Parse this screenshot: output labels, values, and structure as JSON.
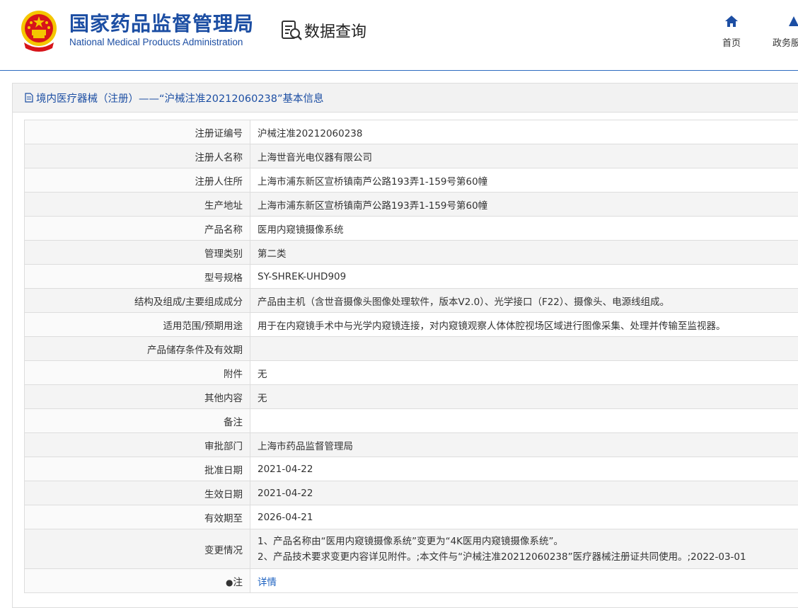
{
  "header": {
    "org_name_cn": "国家药品监督管理局",
    "org_name_en": "National Medical Products Administration",
    "section_title": "数据查询",
    "nav": [
      {
        "label": "首页",
        "icon": "home-icon"
      },
      {
        "label": "政务服",
        "icon": "gov-icon"
      }
    ]
  },
  "panel": {
    "title": "境内医疗器械（注册）——“沪械注准20212060238”基本信息"
  },
  "rows": [
    {
      "label": "注册证编号",
      "value": "沪械注准20212060238"
    },
    {
      "label": "注册人名称",
      "value": "上海世音光电仪器有限公司"
    },
    {
      "label": "注册人住所",
      "value": "上海市浦东新区宣桥镇南芦公路193弄1-159号第60幢"
    },
    {
      "label": "生产地址",
      "value": "上海市浦东新区宣桥镇南芦公路193弄1-159号第60幢"
    },
    {
      "label": "产品名称",
      "value": "医用内窥镜摄像系统"
    },
    {
      "label": "管理类别",
      "value": "第二类"
    },
    {
      "label": "型号规格",
      "value": "SY-SHREK-UHD909"
    },
    {
      "label": "结构及组成/主要组成成分",
      "value": "产品由主机（含世音摄像头图像处理软件，版本V2.0）、光学接口（F22）、摄像头、电源线组成。"
    },
    {
      "label": "适用范围/预期用途",
      "value": "用于在内窥镜手术中与光学内窥镜连接，对内窥镜观察人体体腔视场区域进行图像采集、处理并传输至监视器。"
    },
    {
      "label": "产品储存条件及有效期",
      "value": ""
    },
    {
      "label": "附件",
      "value": "无"
    },
    {
      "label": "其他内容",
      "value": "无"
    },
    {
      "label": "备注",
      "value": ""
    },
    {
      "label": "审批部门",
      "value": "上海市药品监督管理局"
    },
    {
      "label": "批准日期",
      "value": "2021-04-22"
    },
    {
      "label": "生效日期",
      "value": "2021-04-22"
    },
    {
      "label": "有效期至",
      "value": "2026-04-21"
    }
  ],
  "change_row": {
    "label": "变更情况",
    "lines": [
      "1、产品名称由“医用内窥镜摄像系统”变更为“4K医用内窥镜摄像系统”。",
      "2、产品技术要求变更内容详见附件。;本文件与“沪械注准20212060238”医疗器械注册证共同使用。;2022-03-01"
    ]
  },
  "note_row": {
    "label": "注",
    "link": "详情"
  },
  "colors": {
    "brand_blue": "#1c4ea3",
    "link_blue": "#1c61c0",
    "emblem_red": "#d7141a",
    "emblem_gold": "#f4c600"
  }
}
